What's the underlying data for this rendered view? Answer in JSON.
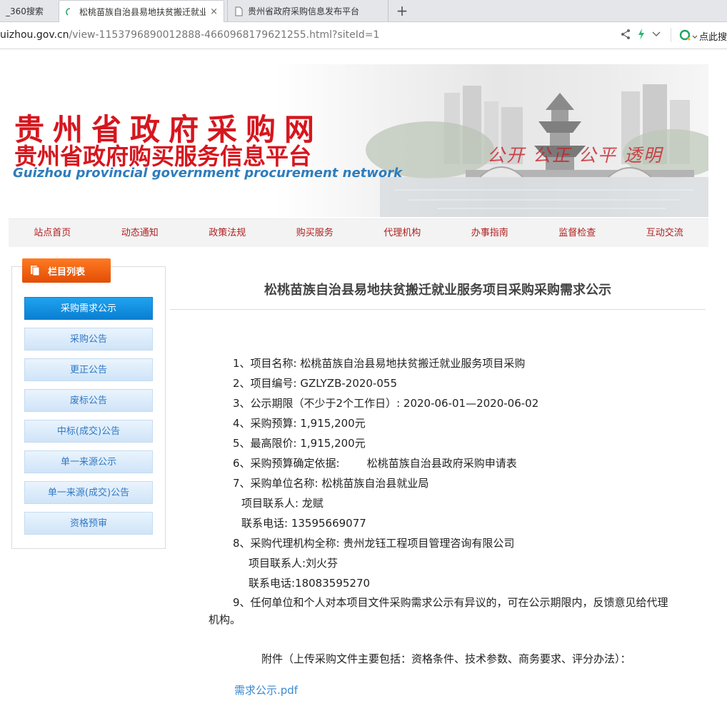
{
  "browser": {
    "tabs": [
      {
        "label": "_360搜索"
      },
      {
        "label": "松桃苗族自治县易地扶贫搬迁就业",
        "close": "×"
      },
      {
        "label": "贵州省政府采购信息发布平台"
      }
    ],
    "new_tab": "+",
    "url_host": "uizhou.gov.cn",
    "url_path": "/view-1153796890012888-4660968179621255.html?siteId=1",
    "search_hint": "点此搜"
  },
  "banner": {
    "title_cn": "贵州省政府采购网",
    "subtitle_cn": "贵州省政府购买服务信息平台",
    "title_en": "Guizhou provincial government procurement network",
    "slogan": "公开 公正 公平 透明"
  },
  "nav": [
    "站点首页",
    "动态通知",
    "政策法规",
    "购买服务",
    "代理机构",
    "办事指南",
    "监督检查",
    "互动交流"
  ],
  "sidebar": {
    "heading": "栏目列表",
    "items": [
      {
        "label": "采购需求公示",
        "active": true
      },
      {
        "label": "采购公告"
      },
      {
        "label": "更正公告"
      },
      {
        "label": "废标公告"
      },
      {
        "label": "中标(成交)公告"
      },
      {
        "label": "单一来源公示"
      },
      {
        "label": "单一来源(成交)公告"
      },
      {
        "label": "资格预审"
      }
    ]
  },
  "article": {
    "title": "松桃苗族自治县易地扶贫搬迁就业服务项目采购采购需求公示",
    "lines": [
      "1、项目名称: 松桃苗族自治县易地扶贫搬迁就业服务项目采购",
      "2、项目编号: GZLYZB-2020-055",
      "3、公示期限（不少于2个工作日）: 2020-06-01—2020-06-02",
      "4、采购预算: 1,915,200元",
      "5、最高限价: 1,915,200元",
      "6、采购预算确定依据:        松桃苗族自治县政府采购申请表",
      "7、采购单位名称: 松桃苗族自治县就业局",
      "项目联系人: 龙赋",
      "联系电话: 13595669077",
      "8、采购代理机构全称: 贵州龙钰工程项目管理咨询有限公司",
      "项目联系人:刘火芬",
      "联系电话:18083595270"
    ],
    "item9": "9、任何单位和个人对本项目文件采购需求公示有异议的，可在公示期限内，反馈意见给代理机构。",
    "attachment_note": "附件（上传采购文件主要包括：资格条件、技术参数、商务要求、评分办法）：",
    "attachment_link": "需求公示.pdf"
  }
}
